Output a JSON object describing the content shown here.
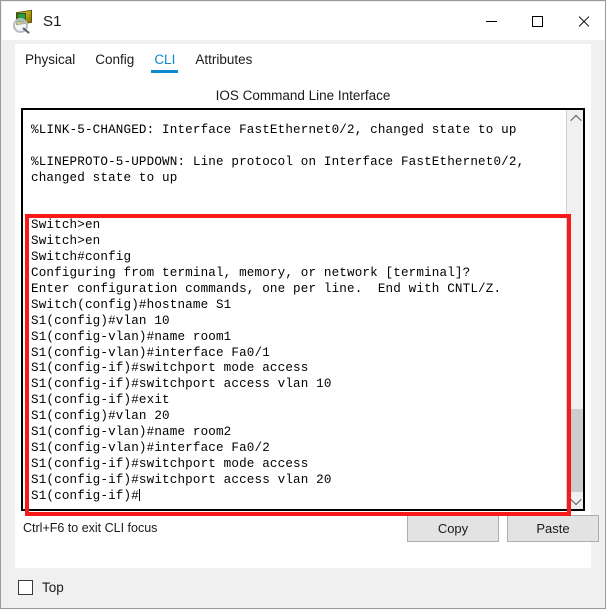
{
  "window": {
    "title": "S1",
    "icon": "switch-magnifier-icon",
    "controls": {
      "minimize": "minimize-icon",
      "maximize": "maximize-icon",
      "close": "close-icon"
    }
  },
  "tabs": [
    {
      "label": "Physical",
      "active": false
    },
    {
      "label": "Config",
      "active": false
    },
    {
      "label": "CLI",
      "active": true
    },
    {
      "label": "Attributes",
      "active": false
    }
  ],
  "panel": {
    "heading": "IOS Command Line Interface"
  },
  "terminal": {
    "lines": [
      "",
      "%LINK-5-CHANGED: Interface FastEthernet0/2, changed state to up",
      "",
      "%LINEPROTO-5-UPDOWN: Line protocol on Interface FastEthernet0/2,",
      "changed state to up",
      "",
      "",
      "Switch>en",
      "Switch>en",
      "Switch#config",
      "Configuring from terminal, memory, or network [terminal]?",
      "Enter configuration commands, one per line.  End with CNTL/Z.",
      "Switch(config)#hostname S1",
      "S1(config)#vlan 10",
      "S1(config-vlan)#name room1",
      "S1(config-vlan)#interface Fa0/1",
      "S1(config-if)#switchport mode access",
      "S1(config-if)#switchport access vlan 10",
      "S1(config-if)#exit",
      "S1(config)#vlan 20",
      "S1(config-vlan)#name room2",
      "S1(config-vlan)#interface Fa0/2",
      "S1(config-if)#switchport mode access",
      "S1(config-if)#switchport access vlan 20",
      "S1(config-if)#"
    ],
    "prompt_line_index": 24
  },
  "scrollbar": {
    "up_arrow": "chevron-up-icon",
    "down_arrow": "chevron-down-icon"
  },
  "footer": {
    "hint": "Ctrl+F6 to exit CLI focus",
    "copy_label": "Copy",
    "paste_label": "Paste"
  },
  "statusbar": {
    "top_label": "Top",
    "top_checked": false
  },
  "annotation": {
    "color": "#f61a1a",
    "shape": "rectangle"
  }
}
